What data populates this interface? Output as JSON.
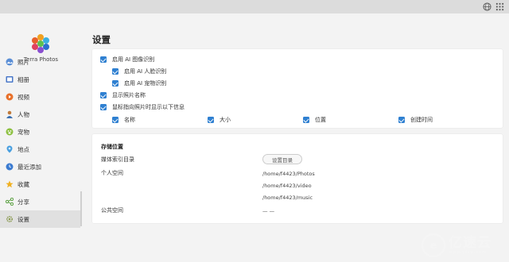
{
  "app": {
    "name": "Terra Photos"
  },
  "sidebar": {
    "items": [
      {
        "label": "照片",
        "icon": "photo-icon"
      },
      {
        "label": "相册",
        "icon": "album-icon"
      },
      {
        "label": "视频",
        "icon": "video-icon"
      },
      {
        "label": "人物",
        "icon": "people-icon"
      },
      {
        "label": "宠物",
        "icon": "pet-icon"
      },
      {
        "label": "地点",
        "icon": "location-icon"
      },
      {
        "label": "最近添加",
        "icon": "recent-icon"
      },
      {
        "label": "收藏",
        "icon": "star-icon"
      },
      {
        "label": "分享",
        "icon": "share-icon"
      },
      {
        "label": "设置",
        "icon": "settings-icon",
        "active": true
      }
    ]
  },
  "page": {
    "title": "设置"
  },
  "ai": {
    "enable_ai": "启用 AI 图像识别",
    "face": "启用 AI 人脸识别",
    "pet": "启用 AI 宠物识别",
    "show_name": "显示照片名称",
    "hover_info": "鼠标指向照片时显示以下信息",
    "fields": [
      "名称",
      "大小",
      "位置",
      "创建时间"
    ]
  },
  "storage": {
    "title": "存储位置",
    "media_index_label": "媒体索引目录",
    "set_dir_button": "设置目录",
    "personal_label": "个人空间",
    "personal_paths": [
      "/home/f4423/Photos",
      "/home/f4423/video",
      "/home/f4423/music"
    ],
    "public_label": "公共空间",
    "public_value": "— —"
  },
  "watermark": {
    "main": "亿速云",
    "sub": "www.yisu.com"
  },
  "colors": {
    "accent": "#2f80d1",
    "active_nav": "#e0e0e0",
    "topbar": "#dcdcdc"
  }
}
